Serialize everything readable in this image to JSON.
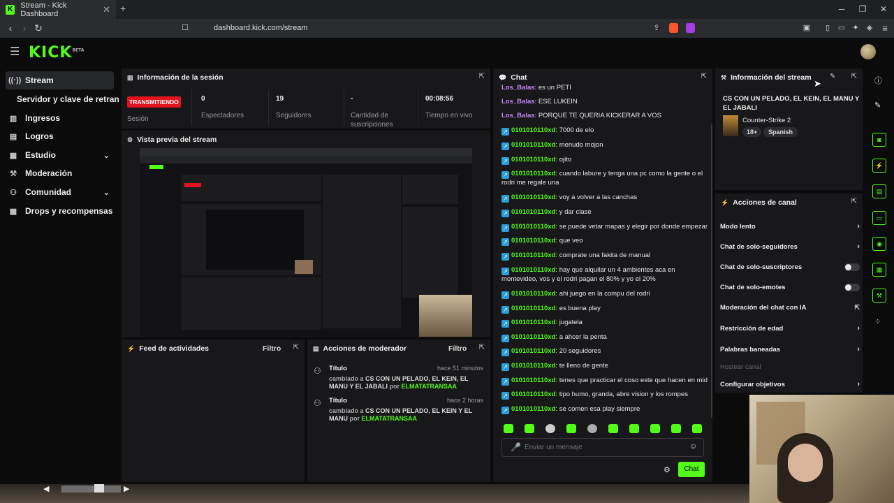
{
  "browser": {
    "tab_title": "Stream - Kick Dashboard",
    "tab_close": "✕",
    "new_tab": "+",
    "url": "dashboard.kick.com/stream",
    "win_min": "─",
    "win_max": "❐",
    "win_close": "✕"
  },
  "header": {
    "logo": "KICK",
    "logo_tag": "BETA"
  },
  "sidebar": {
    "items": [
      {
        "label": "Stream",
        "icon": "broadcast-icon"
      },
      {
        "label": "Servidor y clave de retransm"
      },
      {
        "label": "Ingresos",
        "icon": "chart-icon"
      },
      {
        "label": "Logros",
        "icon": "trophy-icon"
      },
      {
        "label": "Estudio",
        "icon": "grid-icon"
      },
      {
        "label": "Moderación",
        "icon": "wrench-icon"
      },
      {
        "label": "Comunidad",
        "icon": "people-icon"
      },
      {
        "label": "Drops y recompensas",
        "icon": "gift-icon"
      }
    ]
  },
  "session": {
    "title": "Información de la sesión",
    "live_badge": "TRANSMITIENDO",
    "stats": [
      {
        "value": "",
        "label": "Sesión"
      },
      {
        "value": "0",
        "label": "Espectadores"
      },
      {
        "value": "19",
        "label": "Seguidores"
      },
      {
        "value": "-",
        "label": "Cantidad de suscripciones"
      },
      {
        "value": "00:08:56",
        "label": "Tiempo en vivo"
      }
    ]
  },
  "preview": {
    "title": "Vista previa del stream"
  },
  "activity": {
    "title": "Feed de actividades",
    "filter": "Filtro"
  },
  "modactions": {
    "title": "Acciones de moderador",
    "filter": "Filtro",
    "items": [
      {
        "title": "Título",
        "ago": "hace 51 minutos",
        "changed": "cambiado a",
        "value": "CS CON UN PELADO, EL KEIN, EL MANU Y EL JABALI",
        "by": "por",
        "user": "ELMATATRANSAA"
      },
      {
        "title": "Título",
        "ago": "hace 2 horas",
        "changed": "cambiado a",
        "value": "CS CON UN PELADO, EL KEIN Y EL MANU",
        "by": "por",
        "user": "ELMATATRANSAA"
      }
    ]
  },
  "chat": {
    "title": "Chat",
    "messages": [
      {
        "user": "Los_Balas",
        "text": "es un PETI"
      },
      {
        "user": "Los_Balas",
        "text": "ESE LUKEIN"
      },
      {
        "user": "Los_Balas",
        "text": "PORQUE TE QUERIA KICKERAR A VOS"
      },
      {
        "user": "0101010110xd",
        "text": "7000 de elo"
      },
      {
        "user": "0101010110xd",
        "text": "menudo mojon"
      },
      {
        "user": "0101010110xd",
        "text": "ojito"
      },
      {
        "user": "0101010110xd",
        "text": "cuando labure y tenga una pc como la gente o el rodri me regale una"
      },
      {
        "user": "0101010110xd",
        "text": "voy a volver a las canchas"
      },
      {
        "user": "0101010110xd",
        "text": "y dar clase"
      },
      {
        "user": "0101010110xd",
        "text": "se puede vetar mapas y elegir por donde empezar"
      },
      {
        "user": "0101010110xd",
        "text": "que veo"
      },
      {
        "user": "0101010110xd",
        "text": "comprate una fakita de manual"
      },
      {
        "user": "0101010110xd",
        "text": "hay que alquilar un 4 ambientes aca en montevideo, vos y el rodri pagan el 80% y yo el 20%"
      },
      {
        "user": "0101010110xd",
        "text": "ahi juego en la compu del rodri"
      },
      {
        "user": "0101010110xd",
        "text": "es buena play"
      },
      {
        "user": "0101010110xd",
        "text": "jugatela"
      },
      {
        "user": "0101010110xd",
        "text": "a ahcer la penta"
      },
      {
        "user": "0101010110xd",
        "text": "20 seguidores"
      },
      {
        "user": "0101010110xd",
        "text": "te lleno de gente"
      },
      {
        "user": "0101010110xd",
        "text": "tenes que practicar el coso este que hacen en mid"
      },
      {
        "user": "0101010110xd",
        "text": "tipo humo, granda, abre vision y los rompes"
      },
      {
        "user": "0101010110xd",
        "text": "se comen esa play siempre"
      }
    ],
    "placeholder": "Enviar un mensaje",
    "send": "Chat"
  },
  "stream_info": {
    "title": "Información del stream",
    "stream_title": "CS CON UN PELADO, EL KEIN, EL MANU Y EL JABALI",
    "game": "Counter-Strike 2",
    "tags": [
      "18+",
      "Spanish"
    ]
  },
  "channel_actions": {
    "title": "Acciones de canal",
    "items": [
      {
        "label": "Modo lento",
        "control": "chevron"
      },
      {
        "label": "Chat de solo-seguidores",
        "control": "chevron"
      },
      {
        "label": "Chat de solo-suscriptores",
        "control": "toggle"
      },
      {
        "label": "Chat de solo-emotes",
        "control": "toggle"
      },
      {
        "label": "Moderación del chat con IA",
        "control": "external"
      },
      {
        "label": "Restricción de edad",
        "control": "chevron"
      },
      {
        "label": "Palabras baneadas",
        "control": "chevron"
      },
      {
        "label": "Hostear canal",
        "control": "none"
      },
      {
        "label": "Configurar objetivos",
        "control": "chevron"
      }
    ]
  },
  "colors": {
    "brand": "#53fc18",
    "live": "#e1131f",
    "panel": "#18181b"
  }
}
